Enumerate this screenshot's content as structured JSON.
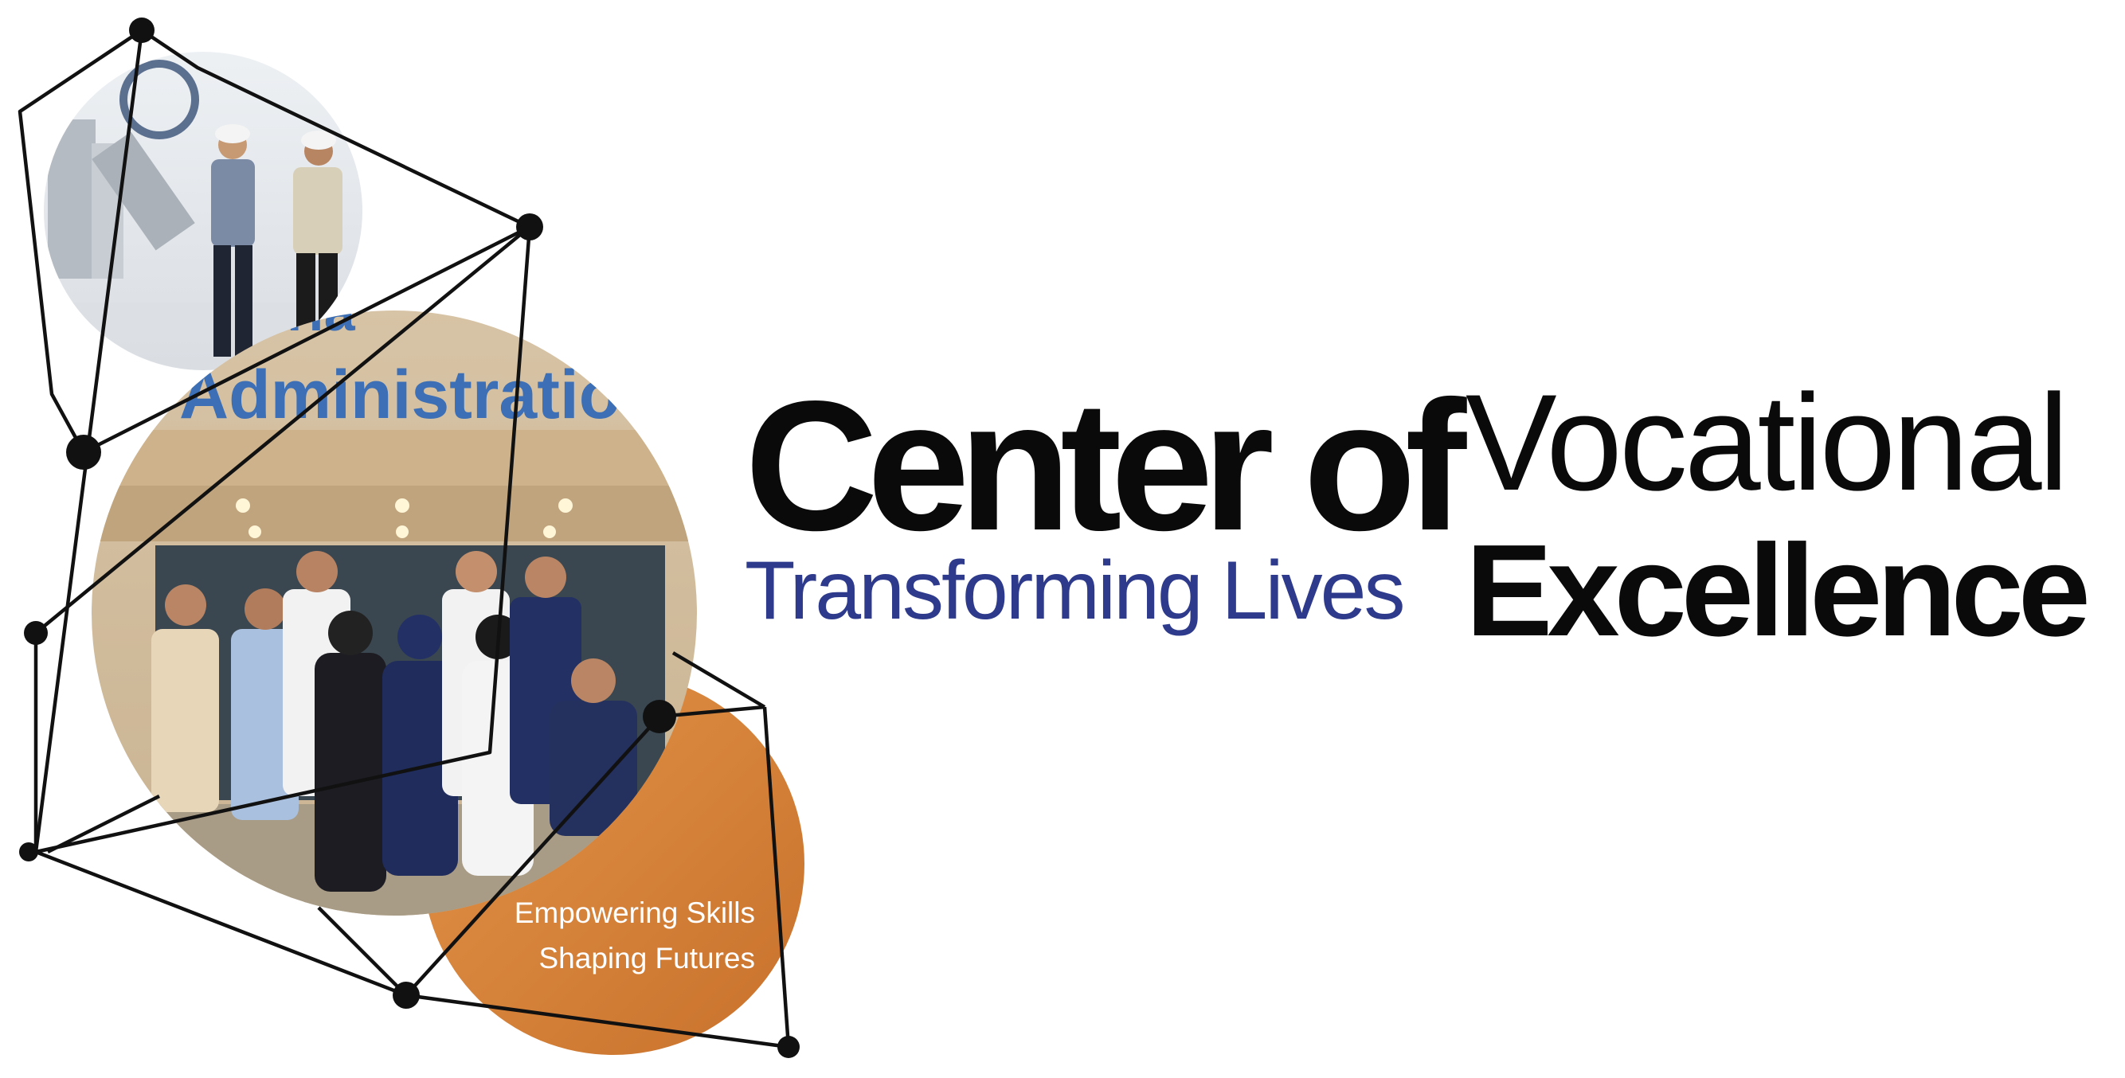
{
  "headline": {
    "center_of": "Center of",
    "vocational": "Vocational",
    "excellence": "Excellence"
  },
  "tagline": "Transforming Lives",
  "badge": {
    "line1": "Empowering Skills",
    "line2": "Shaping Futures"
  },
  "photo": {
    "sign_text": "Administratio",
    "sign_text_partial": "ustria"
  },
  "colors": {
    "text_dark": "#0a0a0a",
    "tagline_blue": "#2e3a8c",
    "badge_orange": "#d4823c",
    "network_line": "#111111"
  }
}
